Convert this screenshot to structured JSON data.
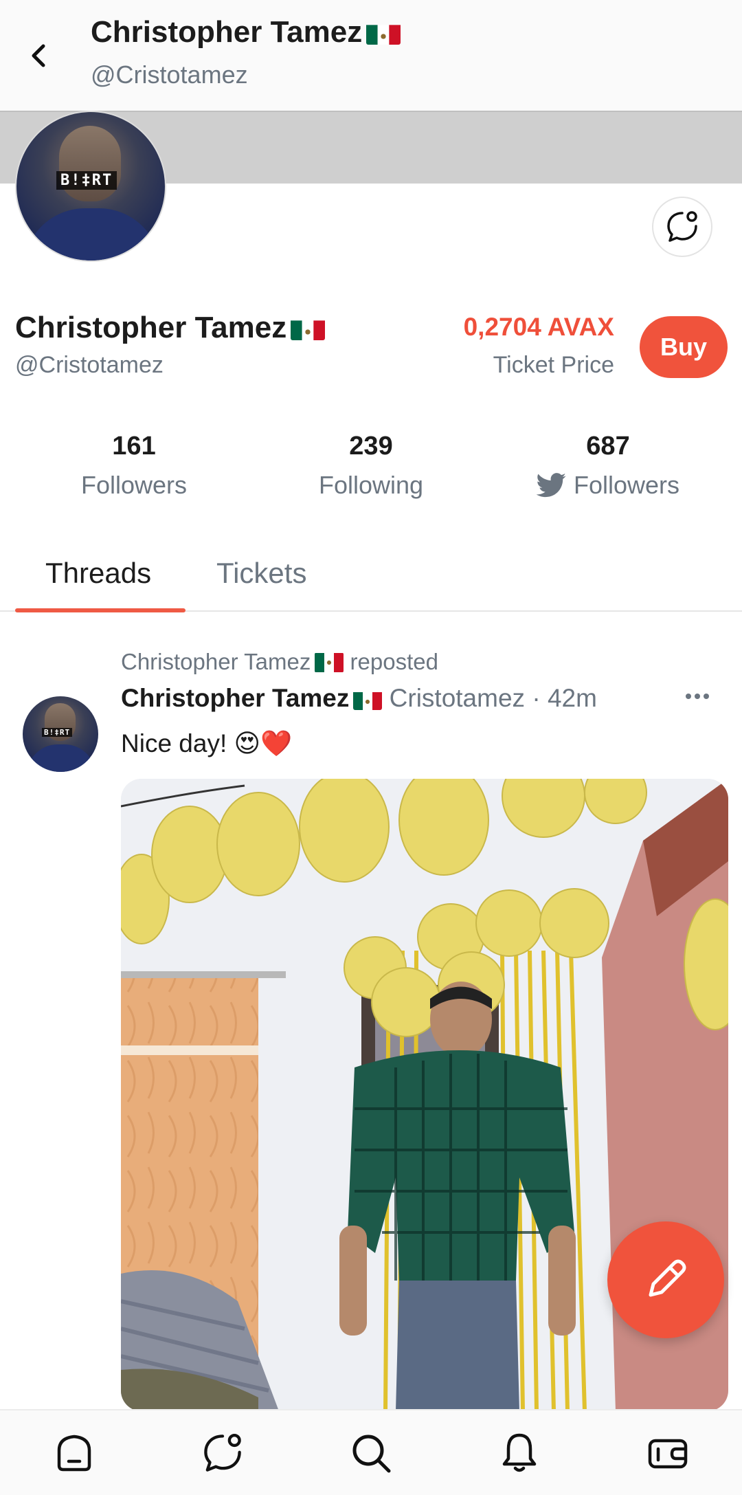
{
  "header": {
    "name": "Christopher Tamez",
    "handle": "@Cristotamez"
  },
  "profile": {
    "name": "Christopher Tamez",
    "handle": "@Cristotamez",
    "ticket_price": "0,2704 AVAX",
    "ticket_price_label": "Ticket Price",
    "buy_label": "Buy",
    "avatar_tag": "B!‡RT"
  },
  "stats": [
    {
      "value": "161",
      "label": "Followers"
    },
    {
      "value": "239",
      "label": "Following"
    },
    {
      "value": "687",
      "label": "Followers",
      "icon": "twitter-icon"
    }
  ],
  "tabs": [
    {
      "label": "Threads",
      "active": true
    },
    {
      "label": "Tickets",
      "active": false
    }
  ],
  "post": {
    "repost_author": "Christopher Tamez",
    "repost_suffix": "reposted",
    "author": "Christopher Tamez",
    "handle": "Cristotamez",
    "separator": "·",
    "time": "42m",
    "text": "Nice day! 😍❤️",
    "avatar_tag": "B!‡RT"
  },
  "nav": [
    {
      "icon": "home-icon"
    },
    {
      "icon": "chat-icon"
    },
    {
      "icon": "search-icon"
    },
    {
      "icon": "bell-icon"
    },
    {
      "icon": "wallet-icon"
    }
  ],
  "colors": {
    "accent": "#f0533c",
    "price": "#ef4f3a",
    "muted": "#6b7580",
    "banner": "#cfcfcf"
  }
}
